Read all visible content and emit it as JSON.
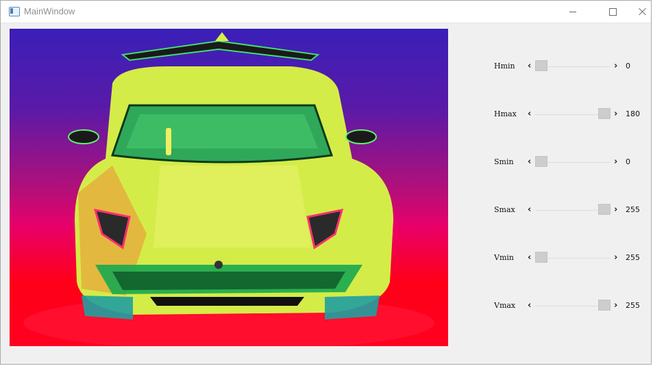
{
  "window": {
    "title": "MainWindow",
    "buttons": {
      "minimize": "minimize-icon",
      "maximize": "maximize-icon",
      "close": "close-icon"
    }
  },
  "image": {
    "subject": "false-color HSV car image"
  },
  "sliders": [
    {
      "label": "Hmin",
      "value": "0",
      "fraction": 0.0
    },
    {
      "label": "Hmax",
      "value": "180",
      "fraction": 1.0
    },
    {
      "label": "Smin",
      "value": "0",
      "fraction": 0.0
    },
    {
      "label": "Smax",
      "value": "255",
      "fraction": 1.0
    },
    {
      "label": "Vmin",
      "value": "255",
      "fraction": 0.0
    },
    {
      "label": "Vmax",
      "value": "255",
      "fraction": 1.0
    }
  ],
  "colors": {
    "car_body": "#d9f04a",
    "background_top": "#3a1fb8",
    "background_bottom": "#ff0020",
    "glass": "#2fbf5a"
  }
}
